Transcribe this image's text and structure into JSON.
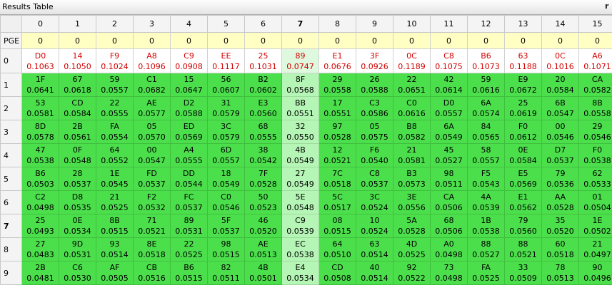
{
  "window": {
    "title": "Results Table",
    "corner_glyph": "r"
  },
  "columns": [
    "0",
    "1",
    "2",
    "3",
    "4",
    "5",
    "6",
    "7",
    "8",
    "9",
    "10",
    "11",
    "12",
    "13",
    "14",
    "15"
  ],
  "highlight_column": 7,
  "pge_row": {
    "label": "PGE",
    "values": [
      "0",
      "0",
      "0",
      "0",
      "0",
      "0",
      "0",
      "0",
      "0",
      "0",
      "0",
      "0",
      "0",
      "0",
      "0",
      "0"
    ]
  },
  "rows": [
    {
      "label": "0",
      "cells": [
        [
          "D0",
          "0.1063"
        ],
        [
          "14",
          "0.1050"
        ],
        [
          "F9",
          "0.1024"
        ],
        [
          "A8",
          "0.1096"
        ],
        [
          "C9",
          "0.0908"
        ],
        [
          "EE",
          "0.1117"
        ],
        [
          "25",
          "0.1031"
        ],
        [
          "89",
          "0.0747"
        ],
        [
          "E1",
          "0.0676"
        ],
        [
          "3F",
          "0.0926"
        ],
        [
          "0C",
          "0.1189"
        ],
        [
          "C8",
          "0.1075"
        ],
        [
          "B6",
          "0.1073"
        ],
        [
          "63",
          "0.1188"
        ],
        [
          "0C",
          "0.1016"
        ],
        [
          "A6",
          "0.1071"
        ]
      ]
    },
    {
      "label": "1",
      "cells": [
        [
          "1F",
          "0.0641"
        ],
        [
          "67",
          "0.0618"
        ],
        [
          "59",
          "0.0557"
        ],
        [
          "C1",
          "0.0682"
        ],
        [
          "15",
          "0.0647"
        ],
        [
          "56",
          "0.0607"
        ],
        [
          "B2",
          "0.0602"
        ],
        [
          "8F",
          "0.0568"
        ],
        [
          "29",
          "0.0558"
        ],
        [
          "26",
          "0.0588"
        ],
        [
          "22",
          "0.0651"
        ],
        [
          "42",
          "0.0614"
        ],
        [
          "59",
          "0.0616"
        ],
        [
          "E9",
          "0.0672"
        ],
        [
          "20",
          "0.0584"
        ],
        [
          "CA",
          "0.0582"
        ]
      ]
    },
    {
      "label": "2",
      "cells": [
        [
          "53",
          "0.0581"
        ],
        [
          "CD",
          "0.0584"
        ],
        [
          "22",
          "0.0555"
        ],
        [
          "AE",
          "0.0577"
        ],
        [
          "D2",
          "0.0588"
        ],
        [
          "31",
          "0.0579"
        ],
        [
          "E3",
          "0.0560"
        ],
        [
          "BB",
          "0.0551"
        ],
        [
          "17",
          "0.0551"
        ],
        [
          "C3",
          "0.0586"
        ],
        [
          "C0",
          "0.0616"
        ],
        [
          "D0",
          "0.0557"
        ],
        [
          "6A",
          "0.0574"
        ],
        [
          "25",
          "0.0619"
        ],
        [
          "6B",
          "0.0547"
        ],
        [
          "8B",
          "0.0558"
        ]
      ]
    },
    {
      "label": "3",
      "cells": [
        [
          "8D",
          "0.0578"
        ],
        [
          "2B",
          "0.0561"
        ],
        [
          "FA",
          "0.0554"
        ],
        [
          "05",
          "0.0570"
        ],
        [
          "ED",
          "0.0569"
        ],
        [
          "3C",
          "0.0579"
        ],
        [
          "68",
          "0.0555"
        ],
        [
          "32",
          "0.0550"
        ],
        [
          "97",
          "0.0528"
        ],
        [
          "05",
          "0.0575"
        ],
        [
          "B8",
          "0.0582"
        ],
        [
          "6A",
          "0.0549"
        ],
        [
          "84",
          "0.0565"
        ],
        [
          "F0",
          "0.0612"
        ],
        [
          "00",
          "0.0546"
        ],
        [
          "29",
          "0.0546"
        ]
      ]
    },
    {
      "label": "4",
      "cells": [
        [
          "47",
          "0.0538"
        ],
        [
          "0F",
          "0.0548"
        ],
        [
          "64",
          "0.0552"
        ],
        [
          "00",
          "0.0547"
        ],
        [
          "A4",
          "0.0555"
        ],
        [
          "6D",
          "0.0557"
        ],
        [
          "38",
          "0.0542"
        ],
        [
          "4B",
          "0.0549"
        ],
        [
          "12",
          "0.0521"
        ],
        [
          "F6",
          "0.0540"
        ],
        [
          "21",
          "0.0581"
        ],
        [
          "45",
          "0.0527"
        ],
        [
          "58",
          "0.0557"
        ],
        [
          "0E",
          "0.0584"
        ],
        [
          "D7",
          "0.0537"
        ],
        [
          "F0",
          "0.0538"
        ]
      ]
    },
    {
      "label": "5",
      "cells": [
        [
          "B6",
          "0.0503"
        ],
        [
          "28",
          "0.0537"
        ],
        [
          "1E",
          "0.0545"
        ],
        [
          "FD",
          "0.0537"
        ],
        [
          "DD",
          "0.0544"
        ],
        [
          "18",
          "0.0549"
        ],
        [
          "7F",
          "0.0528"
        ],
        [
          "27",
          "0.0549"
        ],
        [
          "7C",
          "0.0518"
        ],
        [
          "C8",
          "0.0537"
        ],
        [
          "B3",
          "0.0573"
        ],
        [
          "98",
          "0.0511"
        ],
        [
          "F5",
          "0.0543"
        ],
        [
          "E5",
          "0.0569"
        ],
        [
          "79",
          "0.0536"
        ],
        [
          "62",
          "0.0533"
        ]
      ]
    },
    {
      "label": "6",
      "cells": [
        [
          "C2",
          "0.0498"
        ],
        [
          "D8",
          "0.0535"
        ],
        [
          "21",
          "0.0525"
        ],
        [
          "F2",
          "0.0532"
        ],
        [
          "FC",
          "0.0537"
        ],
        [
          "C0",
          "0.0546"
        ],
        [
          "50",
          "0.0523"
        ],
        [
          "5E",
          "0.0548"
        ],
        [
          "5C",
          "0.0517"
        ],
        [
          "3C",
          "0.0524"
        ],
        [
          "3E",
          "0.0556"
        ],
        [
          "CA",
          "0.0506"
        ],
        [
          "4A",
          "0.0539"
        ],
        [
          "E1",
          "0.0562"
        ],
        [
          "AA",
          "0.0528"
        ],
        [
          "01",
          "0.0504"
        ]
      ]
    },
    {
      "label": "7",
      "cells": [
        [
          "25",
          "0.0493"
        ],
        [
          "0E",
          "0.0534"
        ],
        [
          "8B",
          "0.0515"
        ],
        [
          "71",
          "0.0521"
        ],
        [
          "89",
          "0.0531"
        ],
        [
          "5F",
          "0.0537"
        ],
        [
          "46",
          "0.0520"
        ],
        [
          "C9",
          "0.0539"
        ],
        [
          "08",
          "0.0515"
        ],
        [
          "10",
          "0.0524"
        ],
        [
          "5A",
          "0.0528"
        ],
        [
          "68",
          "0.0506"
        ],
        [
          "1B",
          "0.0538"
        ],
        [
          "79",
          "0.0560"
        ],
        [
          "35",
          "0.0520"
        ],
        [
          "1E",
          "0.0502"
        ]
      ]
    },
    {
      "label": "8",
      "cells": [
        [
          "27",
          "0.0483"
        ],
        [
          "9D",
          "0.0531"
        ],
        [
          "93",
          "0.0514"
        ],
        [
          "8E",
          "0.0518"
        ],
        [
          "22",
          "0.0525"
        ],
        [
          "98",
          "0.0515"
        ],
        [
          "AE",
          "0.0513"
        ],
        [
          "EC",
          "0.0538"
        ],
        [
          "64",
          "0.0510"
        ],
        [
          "63",
          "0.0514"
        ],
        [
          "4D",
          "0.0525"
        ],
        [
          "A0",
          "0.0498"
        ],
        [
          "88",
          "0.0527"
        ],
        [
          "88",
          "0.0521"
        ],
        [
          "60",
          "0.0518"
        ],
        [
          "21",
          "0.0497"
        ]
      ]
    },
    {
      "label": "9",
      "cells": [
        [
          "2B",
          "0.0481"
        ],
        [
          "C6",
          "0.0530"
        ],
        [
          "AF",
          "0.0505"
        ],
        [
          "CB",
          "0.0516"
        ],
        [
          "B6",
          "0.0515"
        ],
        [
          "82",
          "0.0511"
        ],
        [
          "4B",
          "0.0501"
        ],
        [
          "E4",
          "0.0534"
        ],
        [
          "CD",
          "0.0508"
        ],
        [
          "40",
          "0.0514"
        ],
        [
          "92",
          "0.0522"
        ],
        [
          "73",
          "0.0498"
        ],
        [
          "FA",
          "0.0525"
        ],
        [
          "33",
          "0.0509"
        ],
        [
          "78",
          "0.0513"
        ],
        [
          "90",
          "0.0496"
        ]
      ]
    }
  ]
}
